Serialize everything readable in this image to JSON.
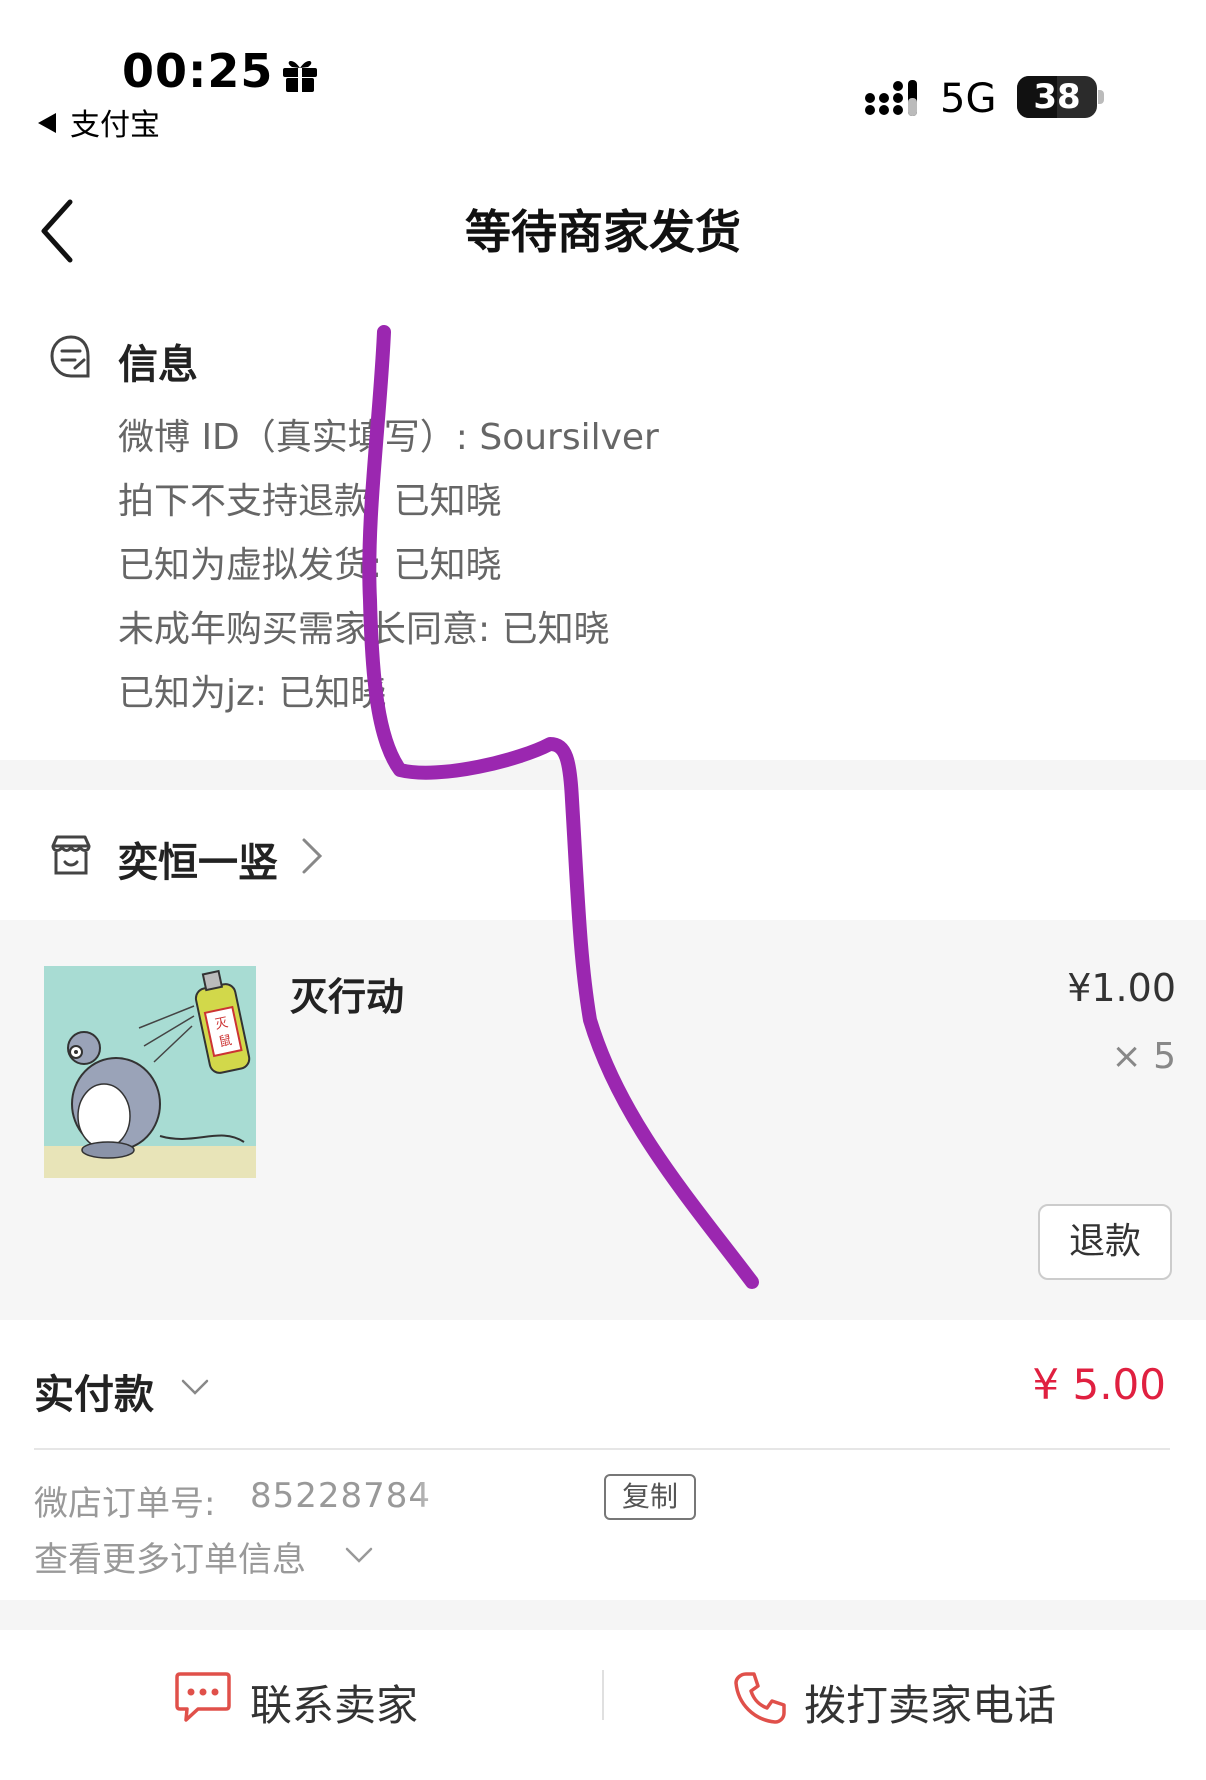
{
  "status_bar": {
    "time": "00:25",
    "back_app": "支付宝",
    "network": "5G",
    "battery": "38"
  },
  "nav": {
    "title": "等待商家发货"
  },
  "info": {
    "heading": "信息",
    "items": [
      "微博 ID（真实填写）: Soursilver",
      "拍下不支持退款: 已知晓",
      "已知为虚拟发货: 已知晓",
      "未成年购买需家长同意: 已知晓",
      "已知为jz: 已知晓"
    ]
  },
  "shop": {
    "name": "奕恒一竖"
  },
  "product": {
    "name": "灭行动",
    "price": "¥1.00",
    "quantity": "× 5",
    "refund_label": "退款",
    "image_text": "灭鼠"
  },
  "payment": {
    "label": "实付款",
    "amount": "¥ 5.00",
    "order_label": "微店订单号:",
    "order_number": "85228784",
    "copy_label": "复制",
    "more_label": "查看更多订单信息"
  },
  "actions": {
    "contact_label": "联系卖家",
    "call_label": "拨打卖家电话"
  },
  "colors": {
    "accent_red": "#e02040",
    "scribble_purple": "#9b27b0"
  }
}
